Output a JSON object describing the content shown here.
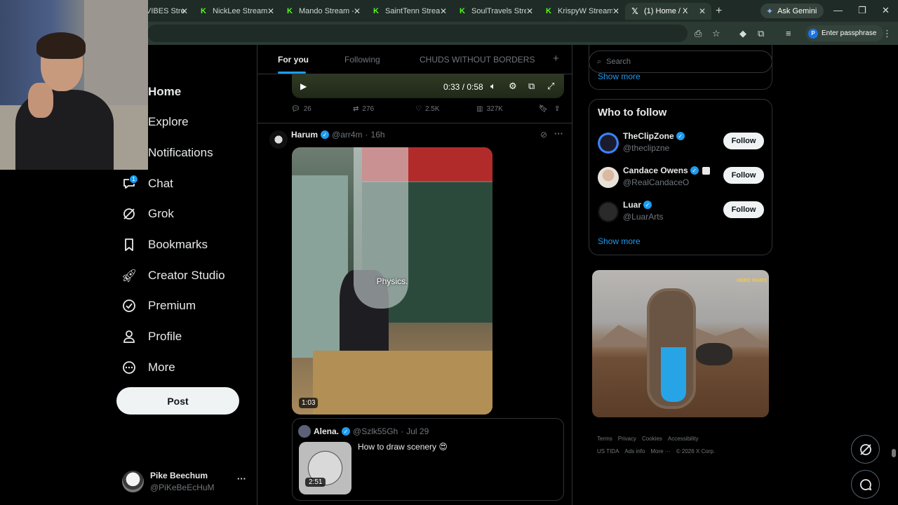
{
  "browser": {
    "tabs": [
      {
        "title": "VIBES Stre",
        "icon": "kick-icon"
      },
      {
        "title": "NickLee Stream -",
        "icon": "kick-icon"
      },
      {
        "title": "Mando Stream - \\",
        "icon": "kick-icon"
      },
      {
        "title": "SaintTenn Stream",
        "icon": "kick-icon"
      },
      {
        "title": "SoulTravels Strea",
        "icon": "kick-icon"
      },
      {
        "title": "KrispyW Stream -",
        "icon": "kick-icon"
      },
      {
        "title": "(1) Home / X",
        "icon": "x-icon"
      }
    ],
    "gemini_label": "Ask Gemini",
    "passphrase_label": "Enter passphrase",
    "passphrase_avatar": "P"
  },
  "nav": {
    "items": [
      {
        "label": "Home",
        "icon": "home-icon"
      },
      {
        "label": "Explore",
        "icon": "search-icon"
      },
      {
        "label": "Notifications",
        "icon": "bell-icon"
      },
      {
        "label": "Chat",
        "icon": "chat-icon"
      },
      {
        "label": "Grok",
        "icon": "grok-icon"
      },
      {
        "label": "Bookmarks",
        "icon": "bookmark-icon"
      },
      {
        "label": "Creator Studio",
        "icon": "rocket-icon"
      },
      {
        "label": "Premium",
        "icon": "premium-icon"
      },
      {
        "label": "Profile",
        "icon": "person-icon"
      },
      {
        "label": "More",
        "icon": "more-circle-icon"
      }
    ],
    "chat_badge": "1",
    "post_label": "Post",
    "account": {
      "name": "Pike Beechum",
      "handle": "@PiKeBeEcHuM"
    }
  },
  "feed": {
    "tabs": [
      "For you",
      "Following",
      "CHUDS WITHOUT BORDERS"
    ],
    "prev_video": {
      "time": "0:33 / 0:58"
    },
    "prev_actions": {
      "replies": "26",
      "reposts": "276",
      "likes": "2.5K",
      "views": "327K"
    },
    "tweet": {
      "name": "Harum",
      "handle": "@arr4m",
      "time": "16h",
      "video_caption": "Physics.",
      "video_duration": "1:03",
      "quote": {
        "name": "Alena.",
        "handle": "@Szlk55Gh",
        "date": "Jul 29",
        "text": "How to draw scenery 😍",
        "duration": "2:51"
      }
    }
  },
  "sidebar": {
    "search_placeholder": "Search",
    "show_more_top": "Show more",
    "who_to_follow_title": "Who to follow",
    "suggestions": [
      {
        "name": "TheClipZone",
        "handle": "@theclipzne",
        "follow": "Follow"
      },
      {
        "name": "Candace Owens",
        "handle": "@RealCandaceO",
        "follow": "Follow"
      },
      {
        "name": "Luar",
        "handle": "@LuarArts",
        "follow": "Follow"
      }
    ],
    "show_more": "Show more",
    "ad_logo": "HERO WARS",
    "footer_row1": [
      "Terms",
      "Privacy",
      "Cookies",
      "Accessibility"
    ],
    "footer_row2": [
      "US TIDA",
      "Ads info",
      "More ···",
      "© 2026 X Corp."
    ]
  }
}
